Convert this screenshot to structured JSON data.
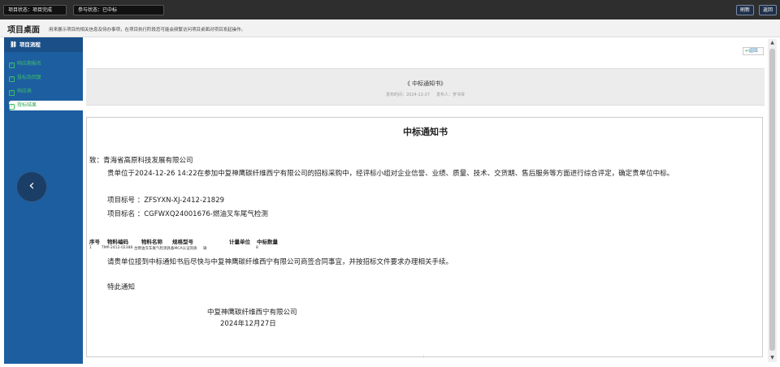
{
  "topbar": {
    "project_status": "项目状态：项目完成",
    "participation_status": "参与状态：已中标",
    "refresh_label": "刷新",
    "back_label": "返回"
  },
  "titlebar": {
    "title": "项目桌面",
    "description": "用来展示项目的相关信息及待办事项，在项目执行阶段您可能会频繁访问项目桌面对项目发起操作。"
  },
  "sidebar": {
    "header": "项目流程",
    "items": [
      {
        "label": "响应期报名"
      },
      {
        "label": "投标及回复"
      },
      {
        "label": "响应表"
      },
      {
        "label": "授标结果"
      }
    ]
  },
  "main": {
    "return_label": "返回",
    "notice_title": "《 中标通知书》",
    "publish_time": "发布时间：2024-12-27",
    "publisher": "发布人：罗书琴"
  },
  "document": {
    "heading": "中标通知书",
    "to": "致：青海省高原科技发展有限公司",
    "body": "贵单位于2024-12-26 14:22在参加中复神鹰碳纤维西宁有限公司的招标采购中，经评标小组对企业信誉、业绩、质量、技术、交货期、售后服务等方面进行综合评定，确定贵单位中标。",
    "project_no": "项目标号 ：ZFSYXN-XJ-2412-21829",
    "project_name": "项目标名 ：CGFWXQ24001676-燃油叉车尾气检测",
    "table_headers": [
      "序号",
      "物料编码",
      "物料名称",
      "规格型号",
      "计量单位",
      "中标数量"
    ],
    "table_row": [
      "1",
      "TMP-2412-02388",
      "台燃油叉车尾气检测具备MCA认证资质",
      "辆",
      "8"
    ],
    "instruction": "请贵单位接到中标通知书后尽快与中复神鹰碳纤维西宁有限公司商签合同事宜，并按招标文件要求办理相关手续。",
    "closing": "特此通知",
    "signature_company": "中复神鹰碳纤维西宁有限公司",
    "signature_date": "2024年12月27日"
  }
}
